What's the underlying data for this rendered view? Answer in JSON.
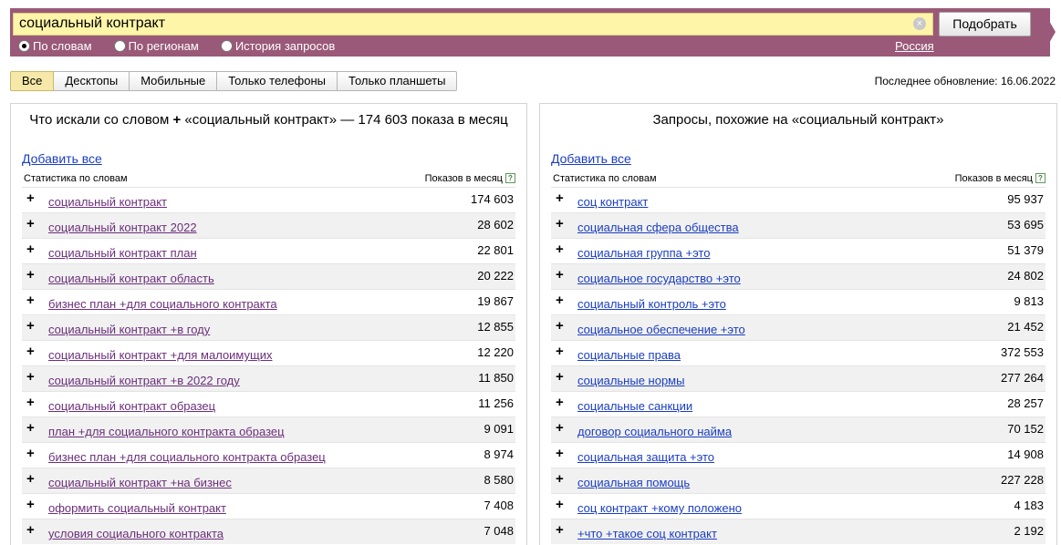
{
  "search": {
    "query": "социальный контракт",
    "clear_glyph": "×",
    "submit_label": "Подобрать"
  },
  "modes": [
    {
      "label": "По словам",
      "checked": true
    },
    {
      "label": "По регионам",
      "checked": false
    },
    {
      "label": "История запросов",
      "checked": false
    }
  ],
  "region": "Россия",
  "device_tabs": [
    {
      "label": "Все",
      "active": true
    },
    {
      "label": "Десктопы",
      "active": false
    },
    {
      "label": "Мобильные",
      "active": false
    },
    {
      "label": "Только телефоны",
      "active": false
    },
    {
      "label": "Только планшеты",
      "active": false
    }
  ],
  "last_update": "Последнее обновление: 16.06.2022",
  "colors": {
    "header": "#9a5978",
    "search_bg": "#fff5a8",
    "visited_link": "#6b2f7a",
    "link": "#1a3dc1"
  },
  "left_panel": {
    "title_part1": "Что искали со словом",
    "plus_glyph": "+",
    "title_part2": "«социальный контракт» — 174 603 показа в месяц",
    "add_all": "Добавить все",
    "col_left": "Статистика по словам",
    "col_right": "Показов в месяц",
    "help_glyph": "?",
    "rows": [
      {
        "phrase": "социальный контракт",
        "count": "174 603"
      },
      {
        "phrase": "социальный контракт 2022",
        "count": "28 602"
      },
      {
        "phrase": "социальный контракт план",
        "count": "22 801"
      },
      {
        "phrase": "социальный контракт область",
        "count": "20 222"
      },
      {
        "phrase": "бизнес план +для социального контракта",
        "count": "19 867"
      },
      {
        "phrase": "социальный контракт +в году",
        "count": "12 855"
      },
      {
        "phrase": "социальный контракт +для малоимущих",
        "count": "12 220"
      },
      {
        "phrase": "социальный контракт +в 2022 году",
        "count": "11 850"
      },
      {
        "phrase": "социальный контракт образец",
        "count": "11 256"
      },
      {
        "phrase": "план +для социального контракта образец",
        "count": "9 091"
      },
      {
        "phrase": "бизнес план +для социального контракта образец",
        "count": "8 974"
      },
      {
        "phrase": "социальный контракт +на бизнес",
        "count": "8 580"
      },
      {
        "phrase": "оформить социальный контракт",
        "count": "7 408"
      },
      {
        "phrase": "условия социального контракта",
        "count": "7 048"
      }
    ]
  },
  "right_panel": {
    "title": "Запросы, похожие на «социальный контракт»",
    "add_all": "Добавить все",
    "col_left": "Статистика по словам",
    "col_right": "Показов в месяц",
    "help_glyph": "?",
    "rows": [
      {
        "phrase": "соц контракт",
        "count": "95 937"
      },
      {
        "phrase": "социальная сфера общества",
        "count": "53 695"
      },
      {
        "phrase": "социальная группа +это",
        "count": "51 379"
      },
      {
        "phrase": "социальное государство +это",
        "count": "24 802"
      },
      {
        "phrase": "социальный контроль +это",
        "count": "9 813"
      },
      {
        "phrase": "социальное обеспечение +это",
        "count": "21 452"
      },
      {
        "phrase": "социальные права",
        "count": "372 553"
      },
      {
        "phrase": "социальные нормы",
        "count": "277 264"
      },
      {
        "phrase": "социальные санкции",
        "count": "28 257"
      },
      {
        "phrase": "договор социального найма",
        "count": "70 152"
      },
      {
        "phrase": "социальная защита +это",
        "count": "14 908"
      },
      {
        "phrase": "социальная помощь",
        "count": "227 228"
      },
      {
        "phrase": "соц контракт +кому положено",
        "count": "4 183"
      },
      {
        "phrase": "+что +такое соц контракт",
        "count": "2 192"
      }
    ]
  }
}
